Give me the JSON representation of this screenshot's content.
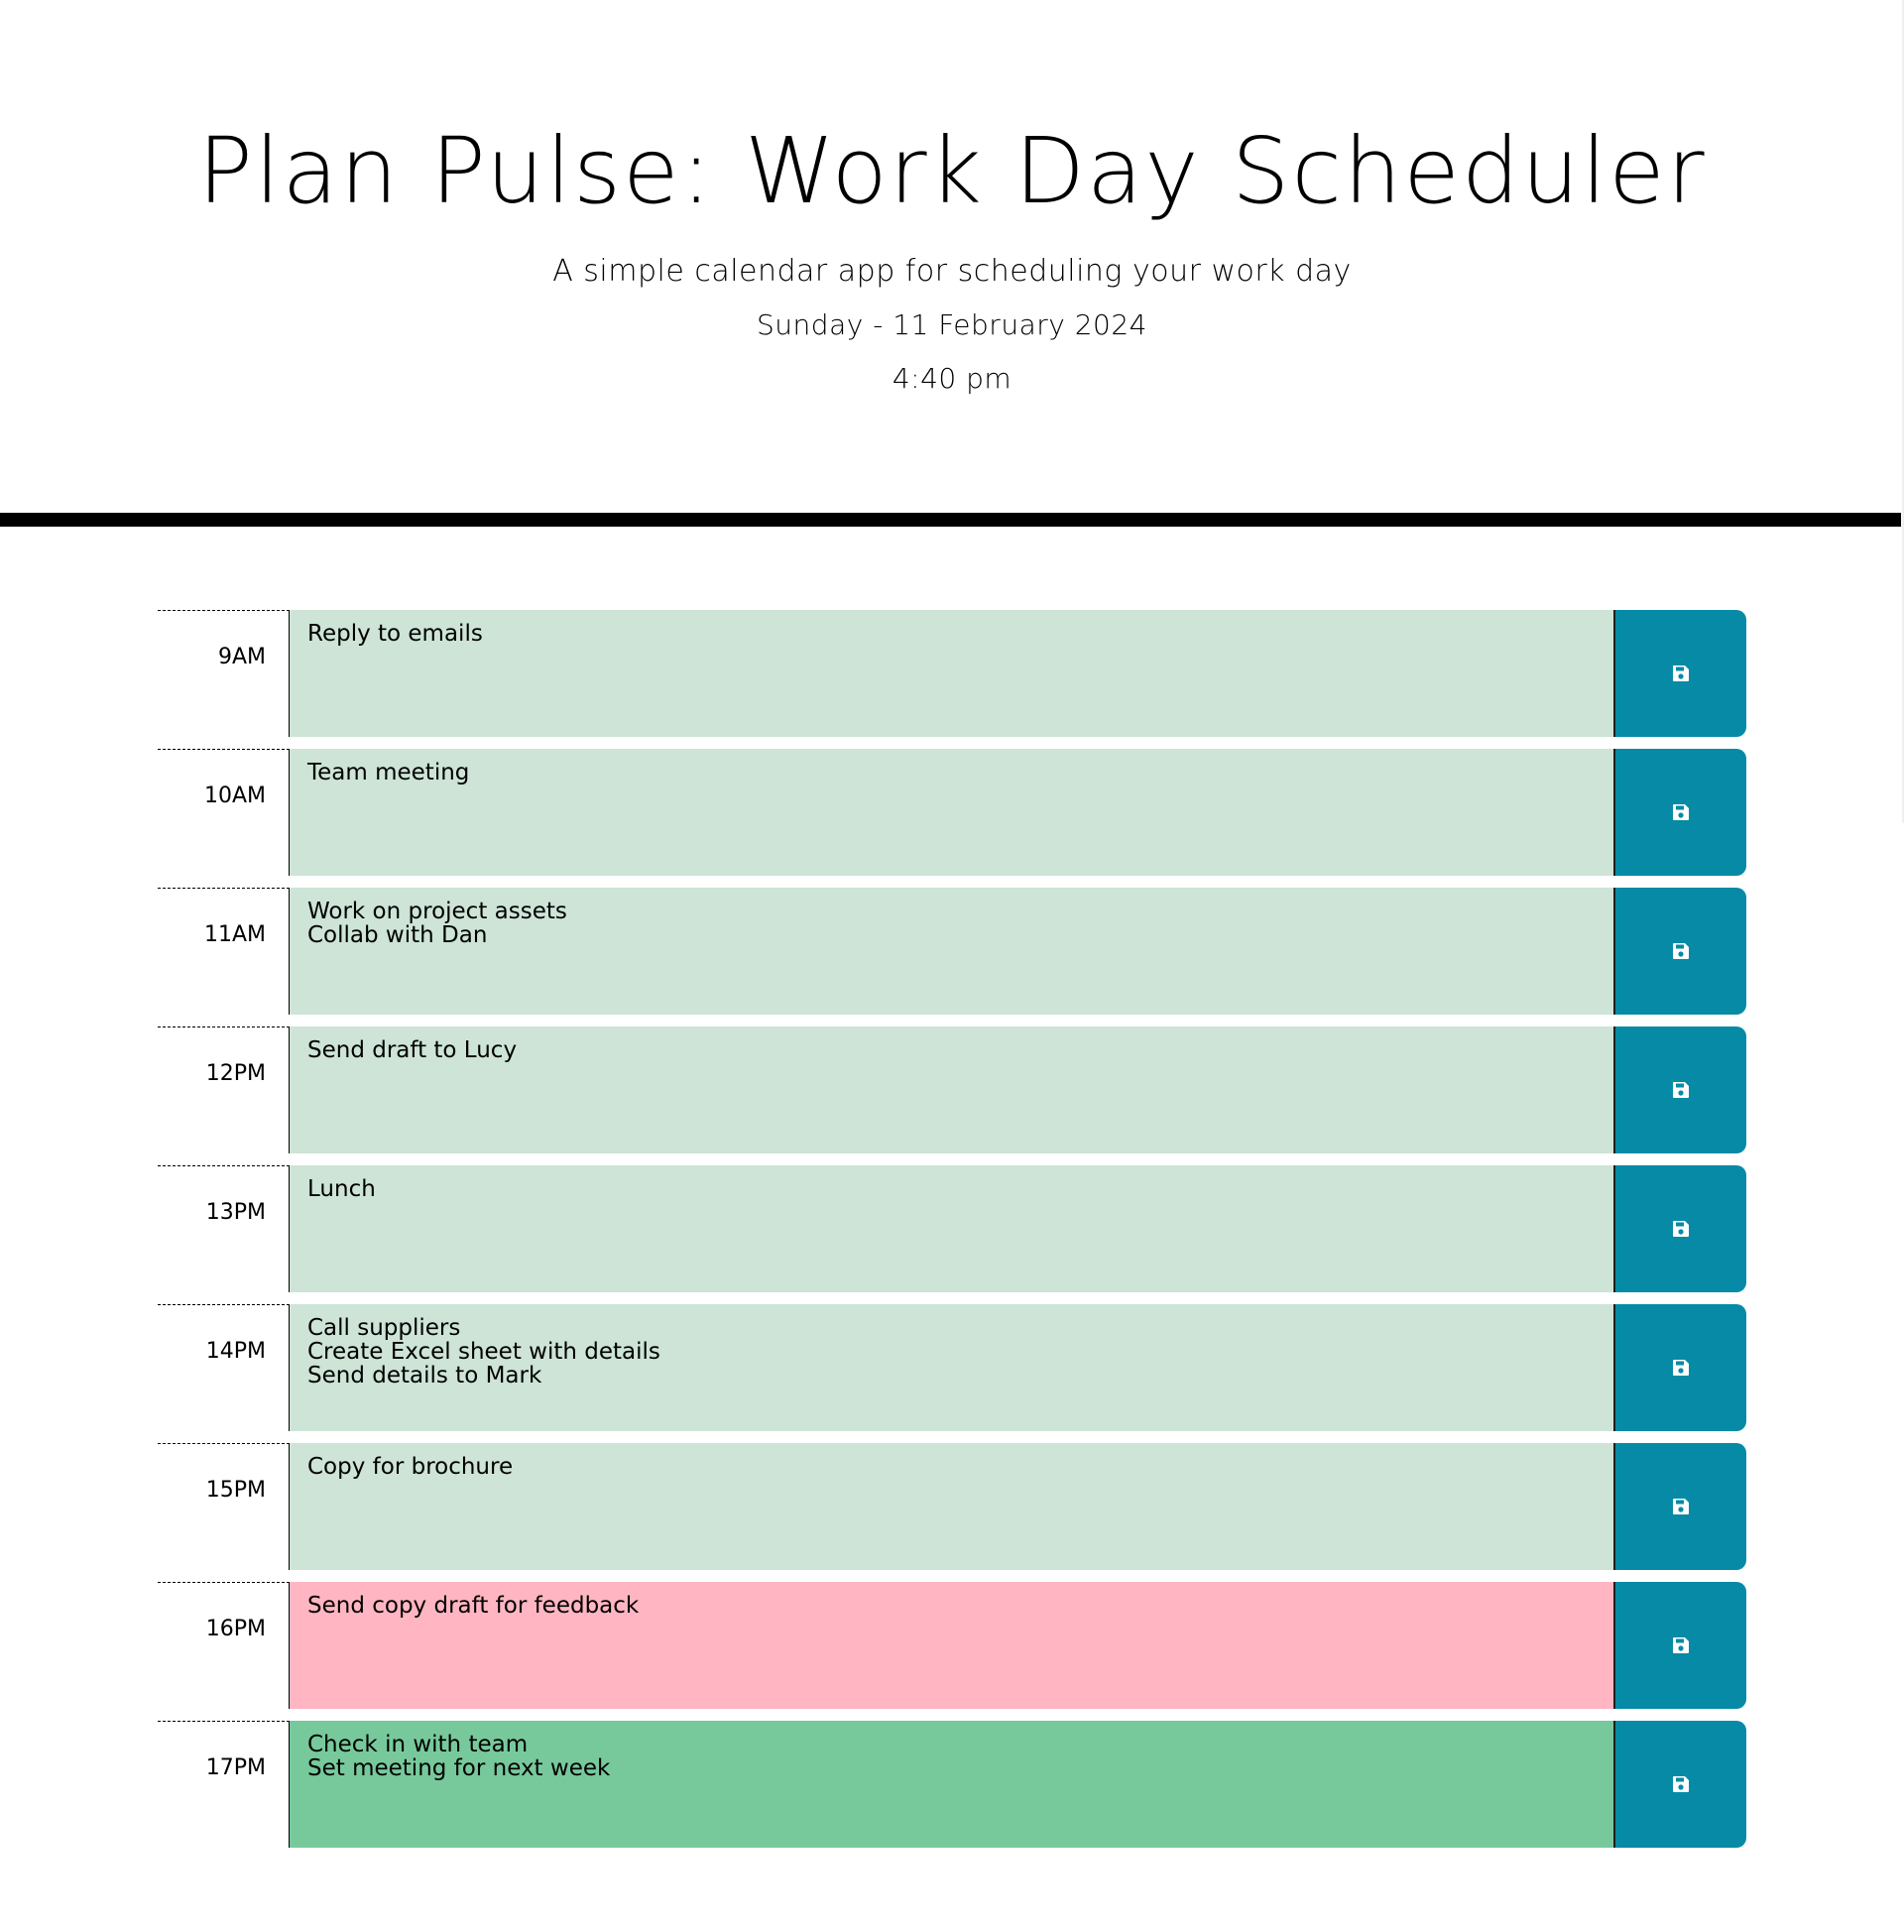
{
  "header": {
    "title": "Plan Pulse: Work Day Scheduler",
    "subtitle": "A simple calendar app for scheduling your work day",
    "date": "Sunday - 11 February 2024",
    "time": "4:40 pm"
  },
  "colors": {
    "past": "#cde4d7",
    "present": "#ffb6c2",
    "future": "#77c99b",
    "save_button": "#068aa6"
  },
  "save_icon": "floppy-disk-icon",
  "schedule": [
    {
      "hour": "9AM",
      "status": "past",
      "lines": [
        "Reply to emails"
      ]
    },
    {
      "hour": "10AM",
      "status": "past",
      "lines": [
        "Team meeting"
      ]
    },
    {
      "hour": "11AM",
      "status": "past",
      "lines": [
        "Work on project assets",
        "Collab with Dan"
      ]
    },
    {
      "hour": "12PM",
      "status": "past",
      "lines": [
        "Send draft to Lucy"
      ]
    },
    {
      "hour": "13PM",
      "status": "past",
      "lines": [
        "Lunch"
      ]
    },
    {
      "hour": "14PM",
      "status": "past",
      "lines": [
        "Call suppliers",
        "Create Excel sheet with details",
        "Send details to Mark"
      ]
    },
    {
      "hour": "15PM",
      "status": "past",
      "lines": [
        "Copy for brochure"
      ]
    },
    {
      "hour": "16PM",
      "status": "present",
      "lines": [
        "Send copy draft for feedback"
      ]
    },
    {
      "hour": "17PM",
      "status": "future",
      "lines": [
        "Check in with team",
        "Set meeting for next week"
      ]
    }
  ]
}
